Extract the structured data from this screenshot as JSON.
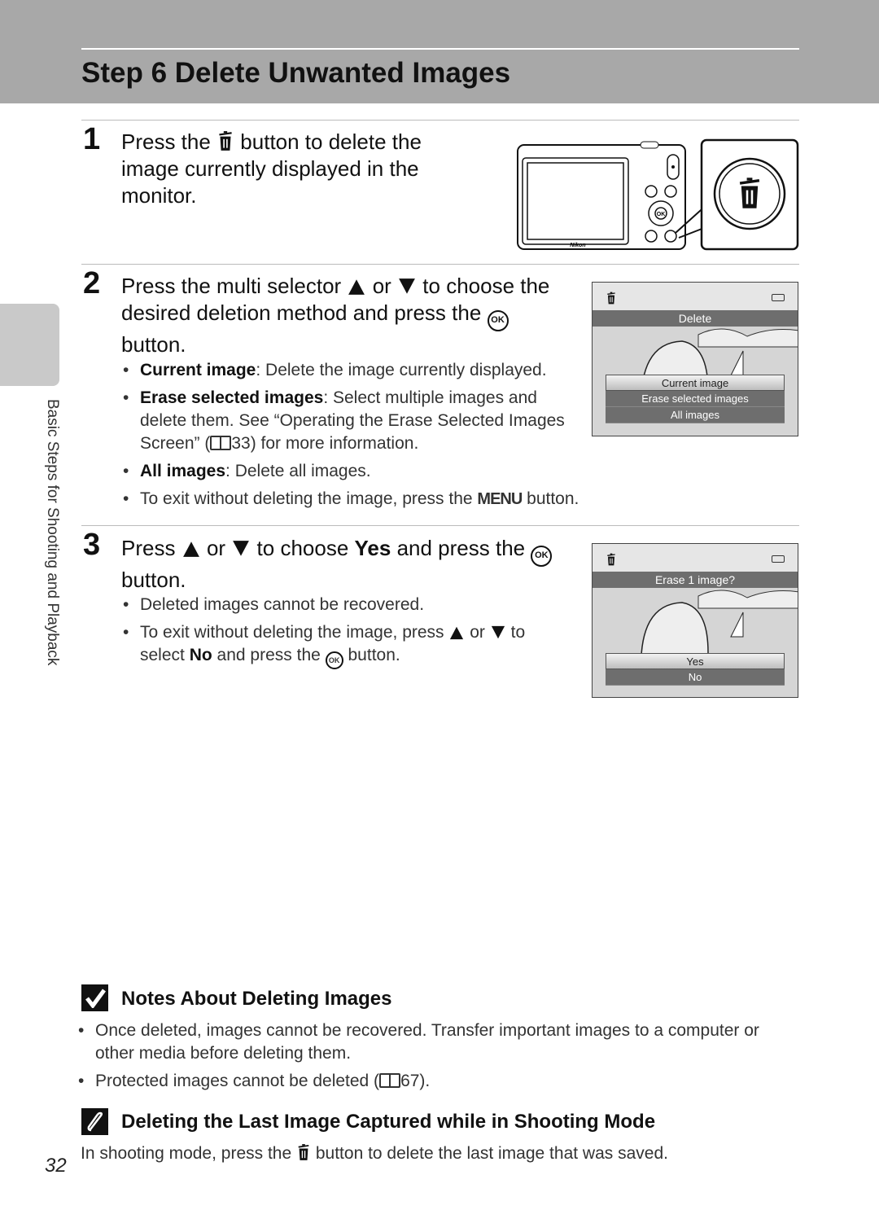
{
  "header": {
    "title": "Step 6 Delete Unwanted Images"
  },
  "side_tab": {
    "label": "Basic Steps for Shooting and Playback"
  },
  "step1": {
    "number": "1",
    "pre": "Press the",
    "post": "button to delete the image currently displayed in the monitor.",
    "camera_brand": "Nikon"
  },
  "step2": {
    "number": "2",
    "pre": "Press the multi selector",
    "or": "or",
    "mid": "to choose the desired deletion method and press the",
    "post": "button.",
    "bullets": [
      {
        "bold": "Current image",
        "text": ": Delete the image currently displayed."
      },
      {
        "bold": "Erase selected images",
        "text": ": Select multiple images and delete them. See “Operating the Erase Selected Images Screen” (",
        "ref": "33",
        "after": ") for more information."
      },
      {
        "bold": "All images",
        "text": ": Delete all images."
      },
      {
        "pre": "To exit without deleting the image, press the",
        "menu": "MENU",
        "post": "button."
      }
    ],
    "screen": {
      "title": "Delete",
      "options": [
        "Current image",
        "Erase selected images",
        "All images"
      ],
      "selected": 0
    }
  },
  "step3": {
    "number": "3",
    "pre": "Press",
    "or": "or",
    "mid": "to choose",
    "yes": "Yes",
    "mid2": "and press the",
    "post": "button.",
    "bullets": [
      {
        "text": "Deleted images cannot be recovered."
      },
      {
        "pre": "To exit without deleting the image, press",
        "or": "or",
        "mid": "to select",
        "no": "No",
        "mid2": "and press the",
        "post": "button."
      }
    ],
    "screen": {
      "title": "Erase 1 image?",
      "options": [
        "Yes",
        "No"
      ],
      "selected": 0
    }
  },
  "notes": {
    "title": "Notes About Deleting Images",
    "items": [
      {
        "text": "Once deleted, images cannot be recovered. Transfer important images to a computer or other media before deleting them."
      },
      {
        "text": "Protected images cannot be deleted (",
        "ref": "67",
        "after": ")."
      }
    ]
  },
  "tip": {
    "title": "Deleting the Last Image Captured while in Shooting Mode",
    "pre": "In shooting mode, press the",
    "post": "button to delete the last image that was saved."
  },
  "ok_label": "OK",
  "page_number": "32"
}
